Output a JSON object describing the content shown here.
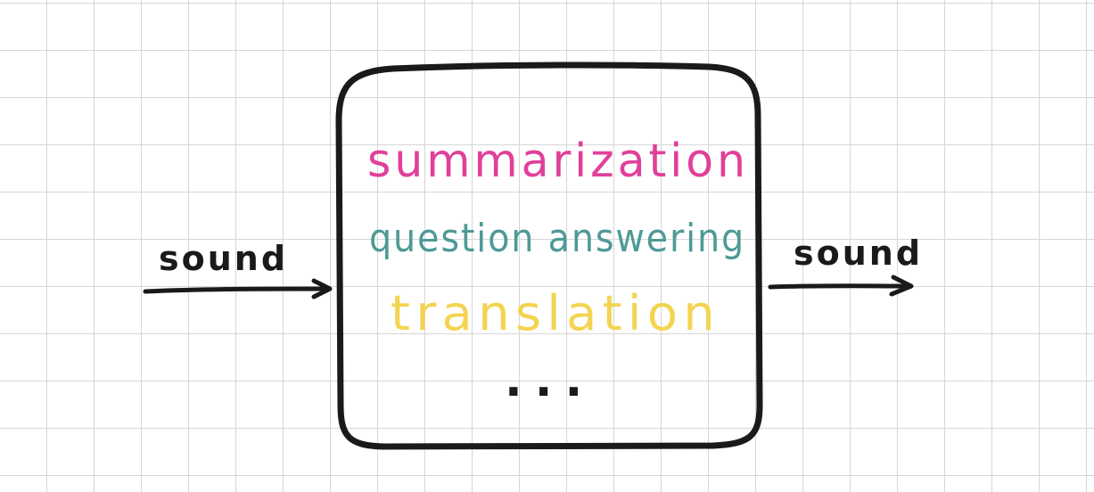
{
  "input_label": "sound",
  "output_label": "sound",
  "tasks": [
    {
      "label": "summarization",
      "color": "#e0409a"
    },
    {
      "label": "question answering",
      "color": "#4e9a96"
    },
    {
      "label": "translation",
      "color": "#f3d452"
    }
  ],
  "ellipsis": "...",
  "colors": {
    "ink": "#1a1a1a",
    "grid": "#d6d6d6"
  }
}
